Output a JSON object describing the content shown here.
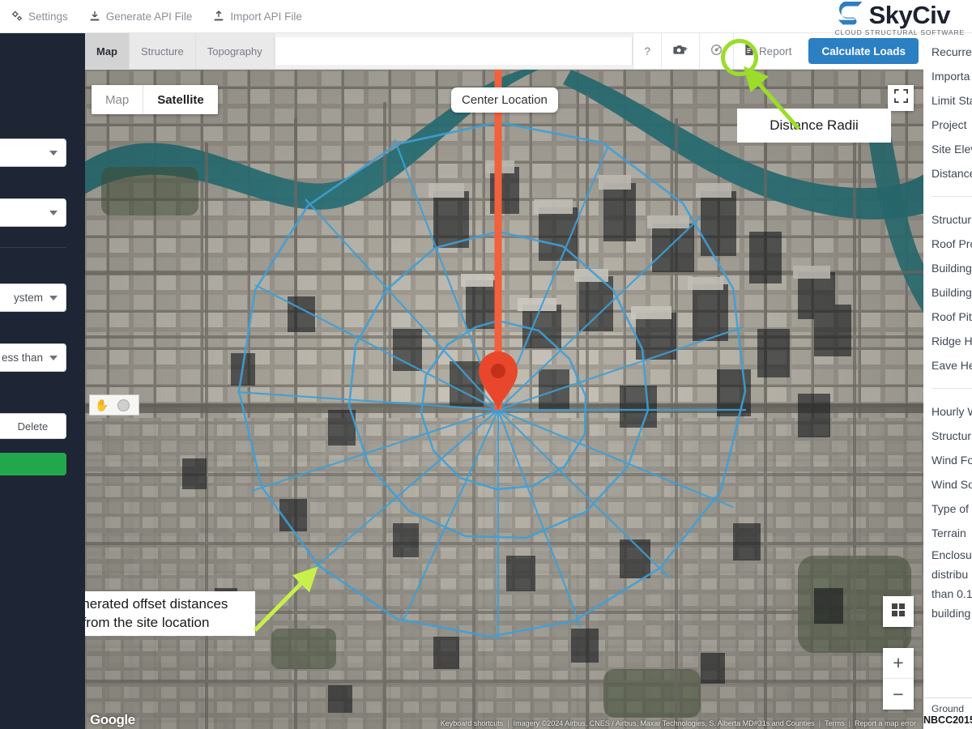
{
  "topbar": {
    "items": [
      {
        "label": "Settings",
        "icon": "gears-icon"
      },
      {
        "label": "Generate API File",
        "icon": "download-icon"
      },
      {
        "label": "Import API File",
        "icon": "upload-icon"
      }
    ],
    "brand_name": "SkyCiv",
    "brand_tagline": "CLOUD STRUCTURAL SOFTWARE",
    "brand_color": "#2b7fc3"
  },
  "toolbar": {
    "tabs": [
      {
        "label": "Map",
        "active": true
      },
      {
        "label": "Structure",
        "active": false
      },
      {
        "label": "Topography",
        "active": false
      }
    ],
    "help_label": "?",
    "screenshot_icon": "camera-plus-icon",
    "radii_icon": "distance-radii-target-icon",
    "report_label": "Report",
    "report_icon": "report-file-icon",
    "calculate_label": "Calculate Loads",
    "calculate_color": "#2b7fc3"
  },
  "map": {
    "type_toggle": [
      {
        "label": "Map",
        "selected": false
      },
      {
        "label": "Satellite",
        "selected": true
      }
    ],
    "center_label": "Center Location",
    "google_logo": "Google",
    "attribution": {
      "keyboard": "Keyboard shortcuts",
      "imagery": "Imagery ©2024 Airbus, CNES / Airbus, Maxar Technologies, S. Alberta MD#31s and Counties",
      "terms": "Terms",
      "report": "Report a map error"
    },
    "zoom_in": "+",
    "zoom_out": "−",
    "marker_color": "#e8472b",
    "radii_color": "#3f9fd6",
    "center_line_color": "#f2603e"
  },
  "annotations": [
    {
      "text": "Distance Radii",
      "highlight_color": "#9bdd2a"
    },
    {
      "text_line1": "Generated offset distances",
      "text_line2": "from the site location",
      "highlight_color": "#c8f04b"
    }
  ],
  "left_panel": {
    "background": "#1e2535",
    "fields": [
      {
        "value": ""
      },
      {
        "value": ""
      },
      {
        "value": "ystem"
      },
      {
        "value": "ess than"
      }
    ],
    "delete_label": "Delete",
    "green_button_color": "#22a84c"
  },
  "right_panel": {
    "group1": [
      "Recurre",
      "Importa",
      "Limit Sta",
      "Project ",
      "Site Elev",
      "Distance"
    ],
    "group2": [
      "Structur",
      "Roof Pro",
      "Building",
      "Building",
      "Roof Pit",
      "Ridge He",
      "Eave He"
    ],
    "group3": [
      "Hourly W",
      "Structur",
      "Wind Fo",
      "Wind So",
      "Type of ",
      "Terrain ",
      "Enclosu",
      "distribu",
      "than 0.1",
      "building"
    ],
    "footer_line1": "Ground",
    "footer_line2": "NBCC2015"
  }
}
